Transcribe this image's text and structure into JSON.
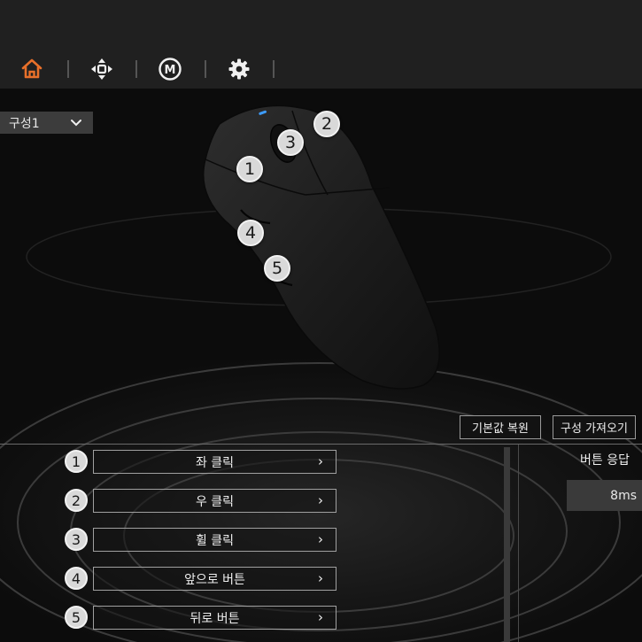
{
  "nav": {
    "items": [
      {
        "icon": "home-icon",
        "active": true
      },
      {
        "icon": "dpad-icon",
        "active": false
      },
      {
        "icon": "macro-icon",
        "label": "M",
        "active": false
      },
      {
        "icon": "gear-icon",
        "active": false
      }
    ],
    "accent": "#e8702a"
  },
  "profile": {
    "selected": "구성1"
  },
  "mouse": {
    "badges": [
      "1",
      "2",
      "3",
      "4",
      "5"
    ]
  },
  "toolbar": {
    "reset_label": "기본값 복원",
    "import_label": "구성 가져오기"
  },
  "buttons": [
    {
      "num": "1",
      "label": "좌 클릭"
    },
    {
      "num": "2",
      "label": "우 클릭"
    },
    {
      "num": "3",
      "label": "휠 클릭"
    },
    {
      "num": "4",
      "label": "앞으로 버튼"
    },
    {
      "num": "5",
      "label": "뒤로 버튼"
    }
  ],
  "response": {
    "label": "버튼 응답",
    "value": "8ms"
  }
}
